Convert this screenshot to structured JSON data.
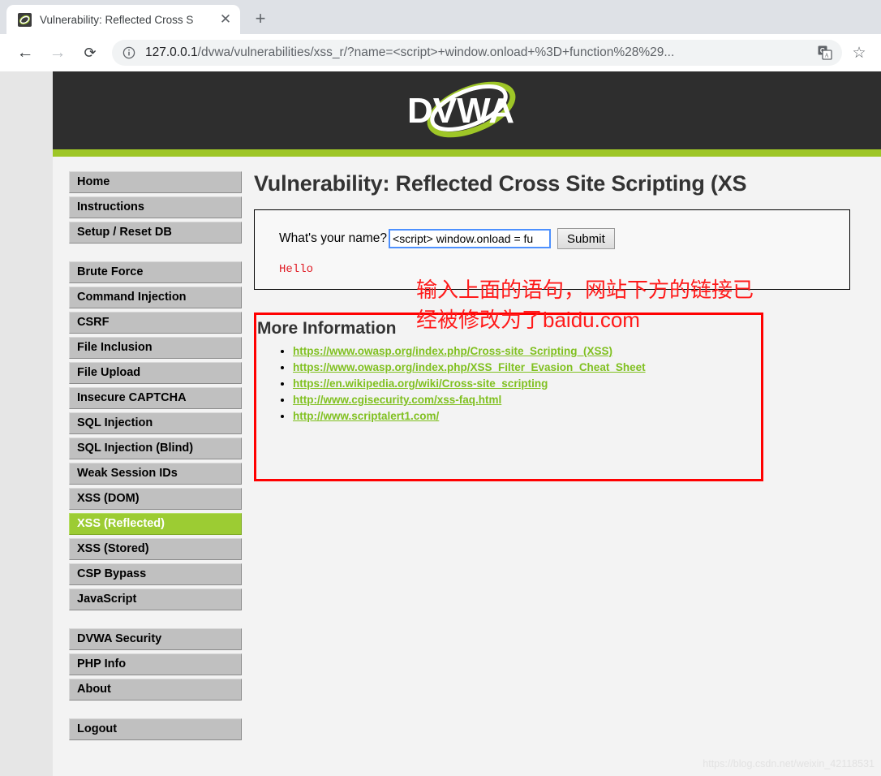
{
  "browser": {
    "tab": {
      "title": "Vulnerability: Reflected Cross S",
      "favicon_name": "dvwa-favicon",
      "close_label": "✕"
    },
    "new_tab_label": "+",
    "back_label": "←",
    "forward_label": "→",
    "reload_label": "⟳",
    "omnibox": {
      "url_host": "127.0.0.1",
      "url_path": "/dvwa/vulnerabilities/xss_r/?name=<script>+window.onload+%3D+function%28%29...",
      "full_url": "127.0.0.1/dvwa/vulnerabilities/xss_r/?name=<script>+window.onload+%3D+function%28%29...",
      "info_icon": "site-information-icon",
      "translate_icon": "google-translate-icon",
      "bookmark_icon": "bookmark-star-icon",
      "bookmark_label": "☆"
    }
  },
  "site": {
    "logo_text": "DVWA",
    "accent_green": "#9ec627",
    "header_dark": "#2e2e2e"
  },
  "sidebar": {
    "groups": [
      {
        "items": [
          {
            "label": "Home",
            "active": false
          },
          {
            "label": "Instructions",
            "active": false
          },
          {
            "label": "Setup / Reset DB",
            "active": false
          }
        ]
      },
      {
        "items": [
          {
            "label": "Brute Force",
            "active": false
          },
          {
            "label": "Command Injection",
            "active": false
          },
          {
            "label": "CSRF",
            "active": false
          },
          {
            "label": "File Inclusion",
            "active": false
          },
          {
            "label": "File Upload",
            "active": false
          },
          {
            "label": "Insecure CAPTCHA",
            "active": false
          },
          {
            "label": "SQL Injection",
            "active": false
          },
          {
            "label": "SQL Injection (Blind)",
            "active": false
          },
          {
            "label": "Weak Session IDs",
            "active": false
          },
          {
            "label": "XSS (DOM)",
            "active": false
          },
          {
            "label": "XSS (Reflected)",
            "active": true
          },
          {
            "label": "XSS (Stored)",
            "active": false
          },
          {
            "label": "CSP Bypass",
            "active": false
          },
          {
            "label": "JavaScript",
            "active": false
          }
        ]
      },
      {
        "items": [
          {
            "label": "DVWA Security",
            "active": false
          },
          {
            "label": "PHP Info",
            "active": false
          },
          {
            "label": "About",
            "active": false
          }
        ]
      },
      {
        "items": [
          {
            "label": "Logout",
            "active": false
          }
        ]
      }
    ]
  },
  "main": {
    "page_title": "Vulnerability: Reflected Cross Site Scripting (XS",
    "form": {
      "label": "What's your name?",
      "input_value": "<script> window.onload = fu",
      "input_placeholder": "",
      "submit_label": "Submit",
      "result_text": "Hello"
    },
    "more_information": {
      "title": "More Information",
      "links": [
        "https://www.owasp.org/index.php/Cross-site_Scripting_(XSS)",
        "https://www.owasp.org/index.php/XSS_Filter_Evasion_Cheat_Sheet",
        "https://en.wikipedia.org/wiki/Cross-site_scripting",
        "http://www.cgisecurity.com/xss-faq.html",
        "http://www.scriptalert1.com/"
      ]
    },
    "annotation": {
      "line1": "输入上面的语句，网站下方的链接已",
      "line2": "经被修改为了baidu.com",
      "color": "#ff1a1a"
    }
  },
  "watermark": "https://blog.csdn.net/weixin_42118531"
}
